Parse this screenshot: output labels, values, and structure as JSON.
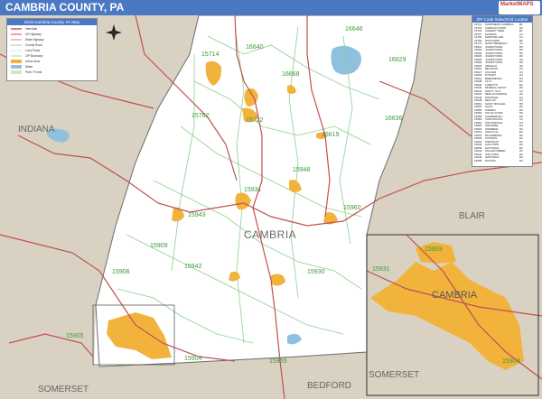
{
  "header": {
    "title": "CAMBRIA COUNTY, PA",
    "logo_text": "MarketMAPS"
  },
  "legend": {
    "title": "2015 Cambria County, PA Map",
    "items": [
      "Interstate",
      "US Highway",
      "State Highway",
      "County Road",
      "Local Road",
      "ZIP Boundary",
      "Urban Area",
      "Water",
      "Park / Forest"
    ]
  },
  "zip_index": {
    "title": "ZIP Code Index/Grid Locator",
    "rows": [
      [
        "15714",
        "NORTHERN CAMBRIA",
        "B1"
      ],
      [
        "15722",
        "CARROLLTOWN",
        "C2"
      ],
      [
        "15724",
        "CHERRY TREE",
        "B1"
      ],
      [
        "15737",
        "ELMORA",
        "C1"
      ],
      [
        "15760",
        "MARSTELLER",
        "C2"
      ],
      [
        "15762",
        "NICKTOWN",
        "B2"
      ],
      [
        "15773",
        "SAINT BENEDICT",
        "C2"
      ],
      [
        "15901",
        "JOHNSTOWN",
        "D5"
      ],
      [
        "15902",
        "JOHNSTOWN",
        "D5"
      ],
      [
        "15904",
        "JOHNSTOWN",
        "D5"
      ],
      [
        "15905",
        "JOHNSTOWN",
        "D6"
      ],
      [
        "15906",
        "JOHNSTOWN",
        "C5"
      ],
      [
        "15909",
        "JOHNSTOWN",
        "D5"
      ],
      [
        "15920",
        "ARMAGH",
        "A5"
      ],
      [
        "15922",
        "BELSANO",
        "C3"
      ],
      [
        "15927",
        "COLVER",
        "C3"
      ],
      [
        "15930",
        "DYSART",
        "D4"
      ],
      [
        "15931",
        "EBENSBURG",
        "D4"
      ],
      [
        "15938",
        "LILLY",
        "E4"
      ],
      [
        "15940",
        "LORETTO",
        "E3"
      ],
      [
        "15942",
        "MINERAL POINT",
        "D5"
      ],
      [
        "15943",
        "NANTY GLO",
        "C4"
      ],
      [
        "15944",
        "NEW FLORENCE",
        "A5"
      ],
      [
        "15946",
        "PORTAGE",
        "E4"
      ],
      [
        "15948",
        "REVLOC",
        "D3"
      ],
      [
        "15951",
        "SAINT MICHAEL",
        "D5"
      ],
      [
        "15952",
        "SALIX",
        "D5"
      ],
      [
        "15955",
        "SIDMAN",
        "D5"
      ],
      [
        "15956",
        "SOUTH FORK",
        "D5"
      ],
      [
        "15958",
        "SUMMERHILL",
        "E5"
      ],
      [
        "15960",
        "TWIN ROCKS",
        "C3"
      ],
      [
        "15961",
        "VINTONDALE",
        "C4"
      ],
      [
        "15962",
        "WILMORE",
        "E4"
      ],
      [
        "15963",
        "WINDBER",
        "D6"
      ],
      [
        "16613",
        "ASHVILLE",
        "E2"
      ],
      [
        "16619",
        "BLANDBURG",
        "D2"
      ],
      [
        "16629",
        "COUPON",
        "E2"
      ],
      [
        "16630",
        "CRESSON",
        "E3"
      ],
      [
        "16636",
        "GALLITZIN",
        "E3"
      ],
      [
        "16639",
        "HASTINGS",
        "D2"
      ],
      [
        "16640",
        "FALLENTIMBER",
        "D1"
      ],
      [
        "16641",
        "GALLITZIN",
        "E3"
      ],
      [
        "16646",
        "HASTINGS",
        "D2"
      ],
      [
        "16668",
        "PATTON",
        "D2"
      ]
    ]
  },
  "map": {
    "regions": {
      "indiana": "INDIANA",
      "blair": "BLAIR",
      "somerset": "SOMERSET",
      "bedford": "BEDFORD",
      "somerset_inset": "SOMERSET"
    },
    "county_label": "CAMBRIA",
    "inset_label": "CAMBRIA",
    "zip_labels": [
      "16640",
      "16646",
      "15714",
      "16668",
      "16629",
      "15762",
      "15722",
      "16636",
      "16619",
      "15948",
      "15931",
      "15943",
      "15960",
      "15909",
      "15942",
      "15906",
      "15930",
      "15904",
      "15905",
      "15955",
      "15931",
      "15909",
      "15904"
    ]
  },
  "colors": {
    "title_bar": "#4a78c2",
    "neighbor": "#d9d2c3",
    "urban": "#f2b33d",
    "water": "#8fc1de",
    "road_major": "#c05050",
    "road_minor": "#8fcf8f",
    "zip_text": "#3a9a3a"
  }
}
